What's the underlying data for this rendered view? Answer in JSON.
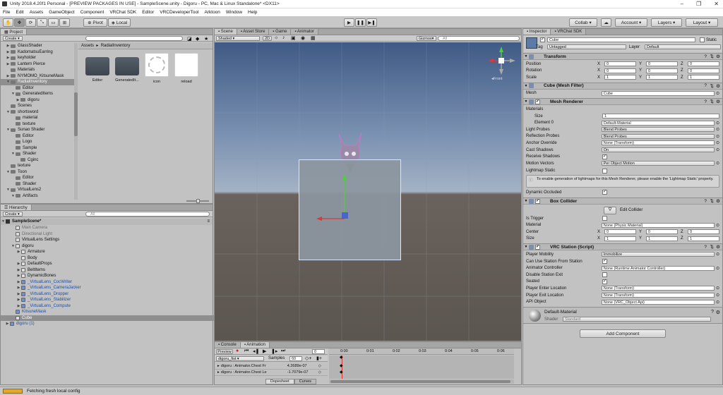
{
  "window": {
    "title": "Unity 2018.4.20f1 Personal - [PREVIEW PACKAGES IN USE] - SampleScene.unity - Digoru - PC, Mac & Linux Standalone* <DX11>"
  },
  "menu": [
    "File",
    "Edit",
    "Assets",
    "GameObject",
    "Component",
    "VRChat SDK",
    "Editor",
    "VRCDeveloperTool",
    "Arktoon",
    "Window",
    "Help"
  ],
  "toolbar": {
    "pivot": "Pivot",
    "local": "Local",
    "collab": "Collab",
    "account": "Account",
    "layers": "Layers",
    "layout": "Layout"
  },
  "project": {
    "tab": "Project",
    "create": "Create",
    "tree": [
      {
        "label": "GlassShader",
        "d": 1,
        "exp": "r"
      },
      {
        "label": "KadomatsuEarring",
        "d": 1,
        "exp": "r"
      },
      {
        "label": "keyholder",
        "d": 1,
        "exp": "r"
      },
      {
        "label": "Lantern Pierce",
        "d": 1,
        "exp": "r"
      },
      {
        "label": "Materials",
        "d": 1,
        "exp": ""
      },
      {
        "label": "NYMOMO_KitsuneMask",
        "d": 1,
        "exp": "r"
      },
      {
        "label": "RadialInventory",
        "d": 1,
        "exp": "d",
        "sel": true
      },
      {
        "label": "Editor",
        "d": 2,
        "exp": ""
      },
      {
        "label": "GeneratedItems",
        "d": 2,
        "exp": "d"
      },
      {
        "label": "digoru",
        "d": 3,
        "exp": "r"
      },
      {
        "label": "Scenes",
        "d": 1,
        "exp": ""
      },
      {
        "label": "shortsword",
        "d": 1,
        "exp": "d"
      },
      {
        "label": "material",
        "d": 2,
        "exp": ""
      },
      {
        "label": "texture",
        "d": 2,
        "exp": ""
      },
      {
        "label": "Sunao Shader",
        "d": 1,
        "exp": "d"
      },
      {
        "label": "Editor",
        "d": 2,
        "exp": ""
      },
      {
        "label": "Logo",
        "d": 2,
        "exp": ""
      },
      {
        "label": "Sample",
        "d": 2,
        "exp": ""
      },
      {
        "label": "Shader",
        "d": 2,
        "exp": "d"
      },
      {
        "label": "Cginc",
        "d": 3,
        "exp": ""
      },
      {
        "label": "texture",
        "d": 1,
        "exp": ""
      },
      {
        "label": "Toon",
        "d": 1,
        "exp": "d"
      },
      {
        "label": "Editor",
        "d": 2,
        "exp": ""
      },
      {
        "label": "Shader",
        "d": 2,
        "exp": ""
      },
      {
        "label": "VirtualLens2",
        "d": 1,
        "exp": "d"
      },
      {
        "label": "Artifacts",
        "d": 2,
        "exp": "d"
      }
    ],
    "breadcrumb": [
      "Assets",
      "RadialInventory"
    ],
    "assets": [
      {
        "label": "Editor",
        "kind": "folder"
      },
      {
        "label": "GeneratedIt...",
        "kind": "folder"
      },
      {
        "label": "icon",
        "kind": "icon"
      },
      {
        "label": "reload",
        "kind": "white"
      }
    ]
  },
  "hierarchy": {
    "tab": "Hierarchy",
    "create": "Create",
    "search": "All",
    "scene": "SampleScene*",
    "items": [
      {
        "label": "Main Camera",
        "d": 1,
        "exp": "",
        "style": "dis"
      },
      {
        "label": "Directional Light",
        "d": 1,
        "exp": "",
        "style": "dis"
      },
      {
        "label": "VirtualLens Settings",
        "d": 1,
        "exp": "",
        "style": ""
      },
      {
        "label": "digoru",
        "d": 1,
        "exp": "d",
        "style": ""
      },
      {
        "label": "Armature",
        "d": 2,
        "exp": "r",
        "style": ""
      },
      {
        "label": "Body",
        "d": 2,
        "exp": "",
        "style": ""
      },
      {
        "label": "DefaultProps",
        "d": 2,
        "exp": "r",
        "style": ""
      },
      {
        "label": "BeltItems",
        "d": 2,
        "exp": "r",
        "style": ""
      },
      {
        "label": "DynamicBones",
        "d": 2,
        "exp": "r",
        "style": ""
      },
      {
        "label": "_VirtualLens_CocWriter",
        "d": 2,
        "exp": "r",
        "style": "prefab"
      },
      {
        "label": "_VirtualLens_CameraJacker",
        "d": 2,
        "exp": "r",
        "style": "prefab"
      },
      {
        "label": "_VirtualLens_Dropper",
        "d": 2,
        "exp": "r",
        "style": "prefab"
      },
      {
        "label": "_VirtualLens_Stabilizer",
        "d": 2,
        "exp": "r",
        "style": "prefab"
      },
      {
        "label": "_VirtualLens_Compute",
        "d": 2,
        "exp": "r",
        "style": "prefab"
      },
      {
        "label": "KitsuneMask",
        "d": 1,
        "exp": "",
        "style": "prefab"
      },
      {
        "label": "Cube",
        "d": 1,
        "exp": "",
        "style": "sel"
      },
      {
        "label": "digoru (1)",
        "d": 0,
        "exp": "r",
        "style": "prefab"
      }
    ]
  },
  "scene": {
    "tabs": [
      "Scene",
      "Asset Store",
      "Game",
      "Animator"
    ],
    "shading": "Shaded",
    "mode2d": "2D",
    "gizmos": "Gizmos",
    "search": "All",
    "persp": "Front"
  },
  "animation": {
    "tabs": [
      "Console",
      "Animation"
    ],
    "preview": "Preview",
    "clip": "digoru_fist",
    "samples_label": "Samples",
    "samples": "60",
    "frame": "0",
    "ticks": [
      "0:00",
      "0:01",
      "0:02",
      "0:03",
      "0:04",
      "0:05",
      "0:06"
    ],
    "props": [
      {
        "name": "digoru : Animator.Chest Fr",
        "val": "4.2689e-07"
      },
      {
        "name": "digoru : Animator.Chest Le",
        "val": "-1.7079e-07"
      }
    ],
    "bottom_tabs": [
      "Dopesheet",
      "Curves"
    ]
  },
  "inspector": {
    "tabs": [
      "Inspector",
      "VRChat SDK"
    ],
    "name": "Cube",
    "static_label": "Static",
    "tag_label": "Tag",
    "tag": "Untagged",
    "layer_label": "Layer",
    "layer": "Default",
    "transform": {
      "title": "Transform",
      "rows": [
        {
          "label": "Position",
          "x": "0",
          "y": "0",
          "z": "0"
        },
        {
          "label": "Rotation",
          "x": "0",
          "y": "0",
          "z": "0"
        },
        {
          "label": "Scale",
          "x": "1",
          "y": "1",
          "z": "1"
        }
      ]
    },
    "meshfilter": {
      "title": "Cube (Mesh Filter)",
      "mesh_label": "Mesh",
      "mesh": "Cube"
    },
    "meshrenderer": {
      "title": "Mesh Renderer",
      "materials": "Materials",
      "size_label": "Size",
      "size": "1",
      "element_label": "Element 0",
      "element": "Default-Material",
      "rows": [
        {
          "label": "Light Probes",
          "val": "Blend Probes",
          "kind": "dd"
        },
        {
          "label": "Reflection Probes",
          "val": "Blend Probes",
          "kind": "dd"
        },
        {
          "label": "Anchor Override",
          "val": "None (Transform)",
          "kind": "fld"
        },
        {
          "label": "Cast Shadows",
          "val": "On",
          "kind": "dd"
        },
        {
          "label": "Receive Shadows",
          "val": "",
          "kind": "chk"
        },
        {
          "label": "Motion Vectors",
          "val": "Per Object Motion",
          "kind": "dd"
        }
      ],
      "lightmap_label": "Lightmap Static",
      "note": "To enable generation of lightmaps for this Mesh Renderer, please enable the 'Lightmap Static' property.",
      "dyn_label": "Dynamic Occluded"
    },
    "boxcollider": {
      "title": "Box Collider",
      "edit": "Edit Collider",
      "trigger_label": "Is Trigger",
      "material_label": "Material",
      "material": "None (Physic Material)",
      "center_label": "Center",
      "cx": "0",
      "cy": "0",
      "cz": "0",
      "size_label": "Size",
      "sx": "1",
      "sy": "1",
      "sz": "1"
    },
    "vrc": {
      "title": "VRC Station (Script)",
      "rows": [
        {
          "label": "Player Mobility",
          "val": "Immobilize",
          "kind": "dd"
        },
        {
          "label": "Can Use Station From Station",
          "val": "",
          "kind": "chk"
        },
        {
          "label": "Animator Controller",
          "val": "None (Runtime Animator Controller)",
          "kind": "fld"
        },
        {
          "label": "Disable Station Exit",
          "val": "",
          "kind": "chkoff"
        },
        {
          "label": "Seated",
          "val": "",
          "kind": "chk"
        },
        {
          "label": "Player Enter Location",
          "val": "None (Transform)",
          "kind": "fld"
        },
        {
          "label": "Player Exit Location",
          "val": "None (Transform)",
          "kind": "fld"
        },
        {
          "label": "API Object",
          "val": "None (VRC_Object Api)",
          "kind": "fld"
        }
      ]
    },
    "material": {
      "name": "Default-Material",
      "shader_label": "Shader",
      "shader": "Standard"
    },
    "add_component": "Add Component"
  },
  "status": {
    "text": "Fetching fresh local config"
  },
  "colors": {
    "selection": "#8f8f8f",
    "prefab": "#1f4fa5",
    "x_axis": "#d83a3a",
    "y_axis": "#4ccf3a",
    "z_axis": "#3a5ad8"
  }
}
